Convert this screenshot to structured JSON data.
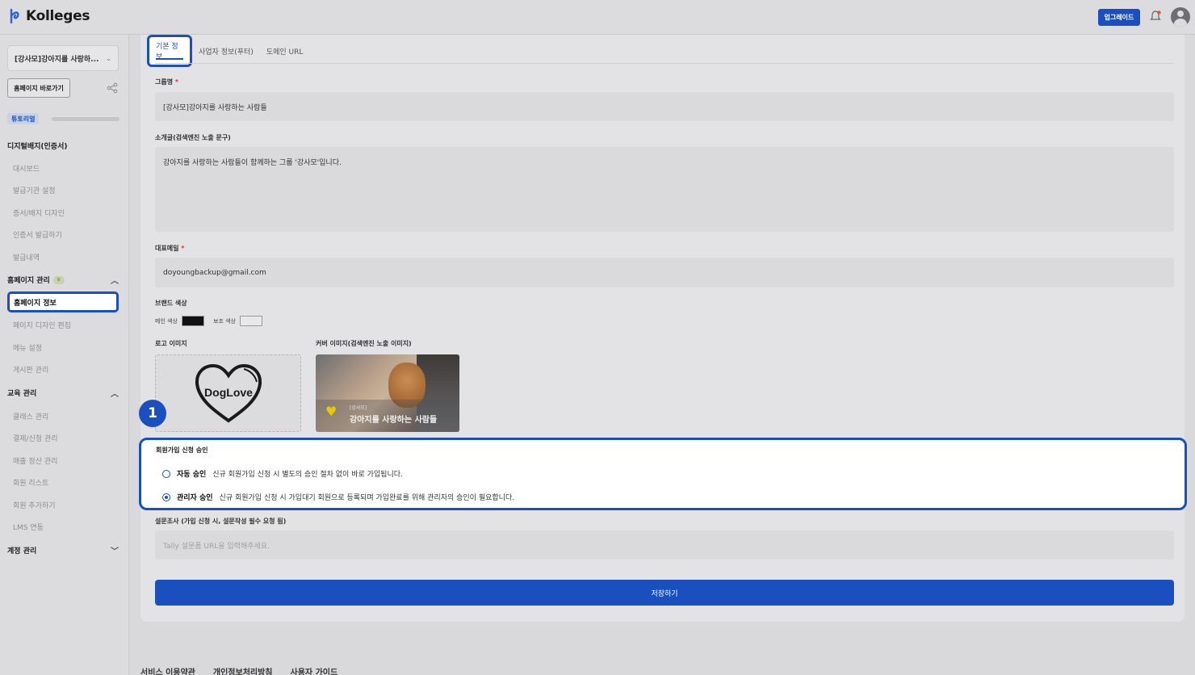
{
  "app": {
    "name": "Kolleges",
    "upgrade_label": "업그레이드"
  },
  "sidebar": {
    "group_name": "[강사모]강아지를 사랑하...",
    "home_button": "홈페이지 바로가기",
    "tutorial_label": "튜토리얼",
    "tutorial_progress": 0.0,
    "sections": [
      {
        "title": "디지털배지(인증서)",
        "items": [
          "대시보드",
          "발급기관 설정",
          "증서/배지 디자인",
          "인증서 발급하기",
          "발급내역"
        ]
      },
      {
        "title": "홈페이지 관리",
        "items": [
          "홈페이지 정보",
          "페이지 디자인 편집",
          "메뉴 설정",
          "게시판 관리"
        ]
      },
      {
        "title": "교육 관리",
        "items": [
          "클래스 관리",
          "결제/신청 관리",
          "매출 정산 관리",
          "회원 리스트",
          "회원 추가하기",
          "LMS 연동"
        ]
      },
      {
        "title": "계정 관리",
        "items": []
      }
    ],
    "active_item": "홈페이지 정보"
  },
  "tabs": [
    "기본 정보",
    "사업자 정보(푸터)",
    "도메인 URL"
  ],
  "form": {
    "group_name_label": "그룹명",
    "group_name_value": "[강사모]강아지를 사랑하는 사람들",
    "intro_label": "소개글(검색엔진 노출 문구)",
    "intro_value": "강아지를 사랑하는 사람들이 함께하는 그룹 '강사모'입니다.",
    "email_label": "대표메일",
    "email_value": "doyoungbackup@gmail.com",
    "brand_color_label": "브랜드 색상",
    "main_color_label": "메인 색상",
    "main_color": "#111111",
    "sub_color_label": "보조 색상",
    "sub_color": "#e8e8ea",
    "logo_label": "로고 이미지",
    "logo_text": "DogLove",
    "cover_label": "커버 이미지(검색엔진 노출 이미지)",
    "cover_small": "[강사모]",
    "cover_title": "강아지를 사랑하는 사람들",
    "approval_title": "회원가입 신청 승인",
    "auto_label": "자동 승인",
    "auto_desc": "신규 회원가입 신청 시 별도의 승인 절차 없이 바로 가입됩니다.",
    "admin_label": "관리자 승인",
    "admin_desc": "신규 회원가입 신청 시 가입대기 회원으로 등록되며 가입완료를 위해 관리자의 승인이 필요합니다.",
    "selected_approval": "admin",
    "survey_label": "설문조사 (가입 신청 시, 설문작성 필수 요청 됨)",
    "survey_placeholder": "Tally 설문폼 URL을 입력해주세요.",
    "save_label": "저장하기"
  },
  "step_badge": "1",
  "footer": [
    "서비스 이용약관",
    "개인정보처리방침",
    "사용자 가이드"
  ],
  "colors": {
    "accent": "#1a4fc0"
  }
}
